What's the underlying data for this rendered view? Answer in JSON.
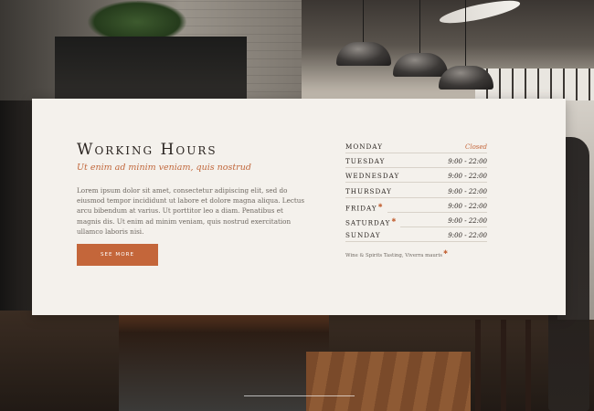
{
  "section": {
    "title": "Working Hours",
    "subtitle": "Ut enim ad minim veniam, quis nostrud",
    "description": "Lorem ipsum dolor sit amet, consectetur adipiscing elit, sed do eiusmod tempor incididunt ut labore et dolore magna aliqua. Lectus arcu bibendum at varius. Ut porttitor leo a diam. Penatibus et magnis dis. Ut enim ad minim veniam, quis nostrud exercitation ullamco laboris nisi.",
    "cta_label": "SEE MORE"
  },
  "hours": [
    {
      "day": "Monday",
      "time": "Closed",
      "closed": true,
      "marked": false
    },
    {
      "day": "Tuesday",
      "time": "9:00 - 22:00",
      "closed": false,
      "marked": false
    },
    {
      "day": "Wednesday",
      "time": "9:00 - 22:00",
      "closed": false,
      "marked": false
    },
    {
      "day": "Thursday",
      "time": "9:00 - 22:00",
      "closed": false,
      "marked": false
    },
    {
      "day": "Friday",
      "time": "9:00 - 22:00",
      "closed": false,
      "marked": true
    },
    {
      "day": "Saturday",
      "time": "9:00 - 22:00",
      "closed": false,
      "marked": true
    },
    {
      "day": "Sunday",
      "time": "9:00 - 22:00",
      "closed": false,
      "marked": false
    }
  ],
  "note": "Wine & Spirits Tasting, Viverra mauris",
  "colors": {
    "accent": "#c4663a",
    "card": "#f4f1ec",
    "text": "#2c2622"
  }
}
